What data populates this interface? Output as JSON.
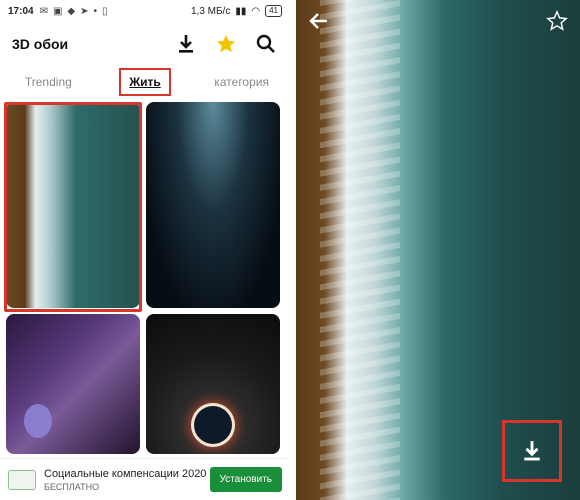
{
  "status_bar": {
    "time": "17:04",
    "net_speed": "1,3 МБ/с",
    "battery": "41"
  },
  "app": {
    "title": "3D обои"
  },
  "tabs": [
    {
      "label": "Trending",
      "active": false
    },
    {
      "label": "Жить",
      "active": true
    },
    {
      "label": "категория",
      "active": false
    }
  ],
  "icons": {
    "download": "download-icon",
    "favorites": "star-icon",
    "search": "search-icon",
    "back": "arrow-left-icon",
    "favorite_outline": "star-outline-icon"
  },
  "colors": {
    "accent_star": "#f5c400",
    "highlight": "#d9352a",
    "install_button": "#1a8f3a"
  },
  "ad": {
    "title": "Социальные компенсации 2020",
    "subtitle": "БЕСПЛАТНО",
    "button": "Установить"
  }
}
